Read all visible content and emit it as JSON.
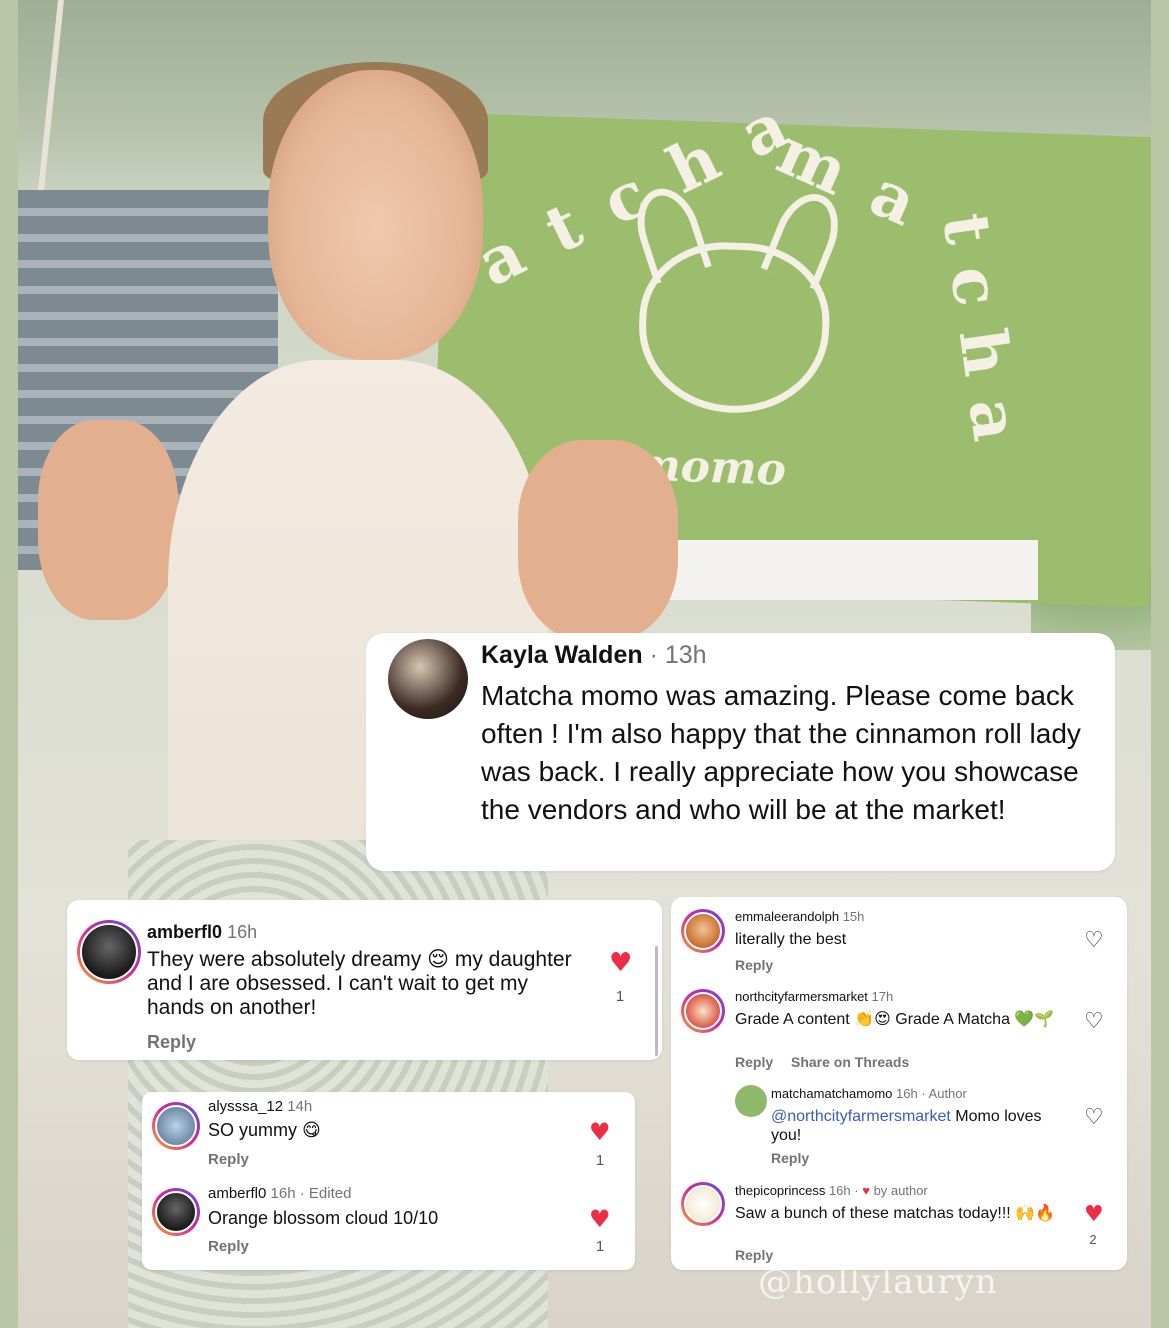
{
  "watermark": "@hollylauryn",
  "banner": {
    "word_left": "atcha",
    "word_mid": "ma",
    "word_right": "tcha",
    "logo_word": "momo"
  },
  "colors": {
    "heart_filled": "#ed2d45",
    "mention": "#3b5bbf",
    "muted": "#737373"
  },
  "kayla": {
    "username": "Kayla Walden",
    "time": "· 13h",
    "text": "Matcha momo was amazing. Please come back often ! I'm also happy that the cinnamon roll lady was back. I really appreciate how you showcase the vendors and who will be at the market!"
  },
  "amber_left": {
    "username": "amberfl0",
    "time": "16h",
    "text": "They were absolutely dreamy 😌 my daughter and I are obsessed. I can't wait to get my hands on another!",
    "reply": "Reply",
    "likes": "1",
    "heart_icon": "heart-filled"
  },
  "lower": {
    "c1": {
      "username": "alysssa_12",
      "time": "14h",
      "text": "SO yummy 😋",
      "reply": "Reply",
      "likes": "1"
    },
    "c2": {
      "username": "amberfl0",
      "time": "16h · Edited",
      "text": "Orange blossom cloud 10/10",
      "reply": "Reply",
      "likes": "1"
    }
  },
  "right": {
    "a": {
      "username": "emmaleerandolph",
      "time": "15h",
      "text": "literally the best",
      "reply": "Reply"
    },
    "b": {
      "username": "northcityfarmersmarket",
      "time": "17h",
      "text": "Grade A content 👏😍 Grade A Matcha 💚🌱",
      "reply": "Reply",
      "threads": "Share on Threads"
    },
    "c": {
      "username": "matchamatchamomo",
      "time": "16h · Author",
      "mention": "@northcityfarmersmarket",
      "text": " Momo loves you!",
      "reply": "Reply"
    },
    "d": {
      "username": "thepicoprincess",
      "time": "16h ·",
      "by_author": "by author",
      "text": "Saw a bunch of these matchas today!!! 🙌🔥",
      "reply": "Reply",
      "likes": "2"
    }
  }
}
